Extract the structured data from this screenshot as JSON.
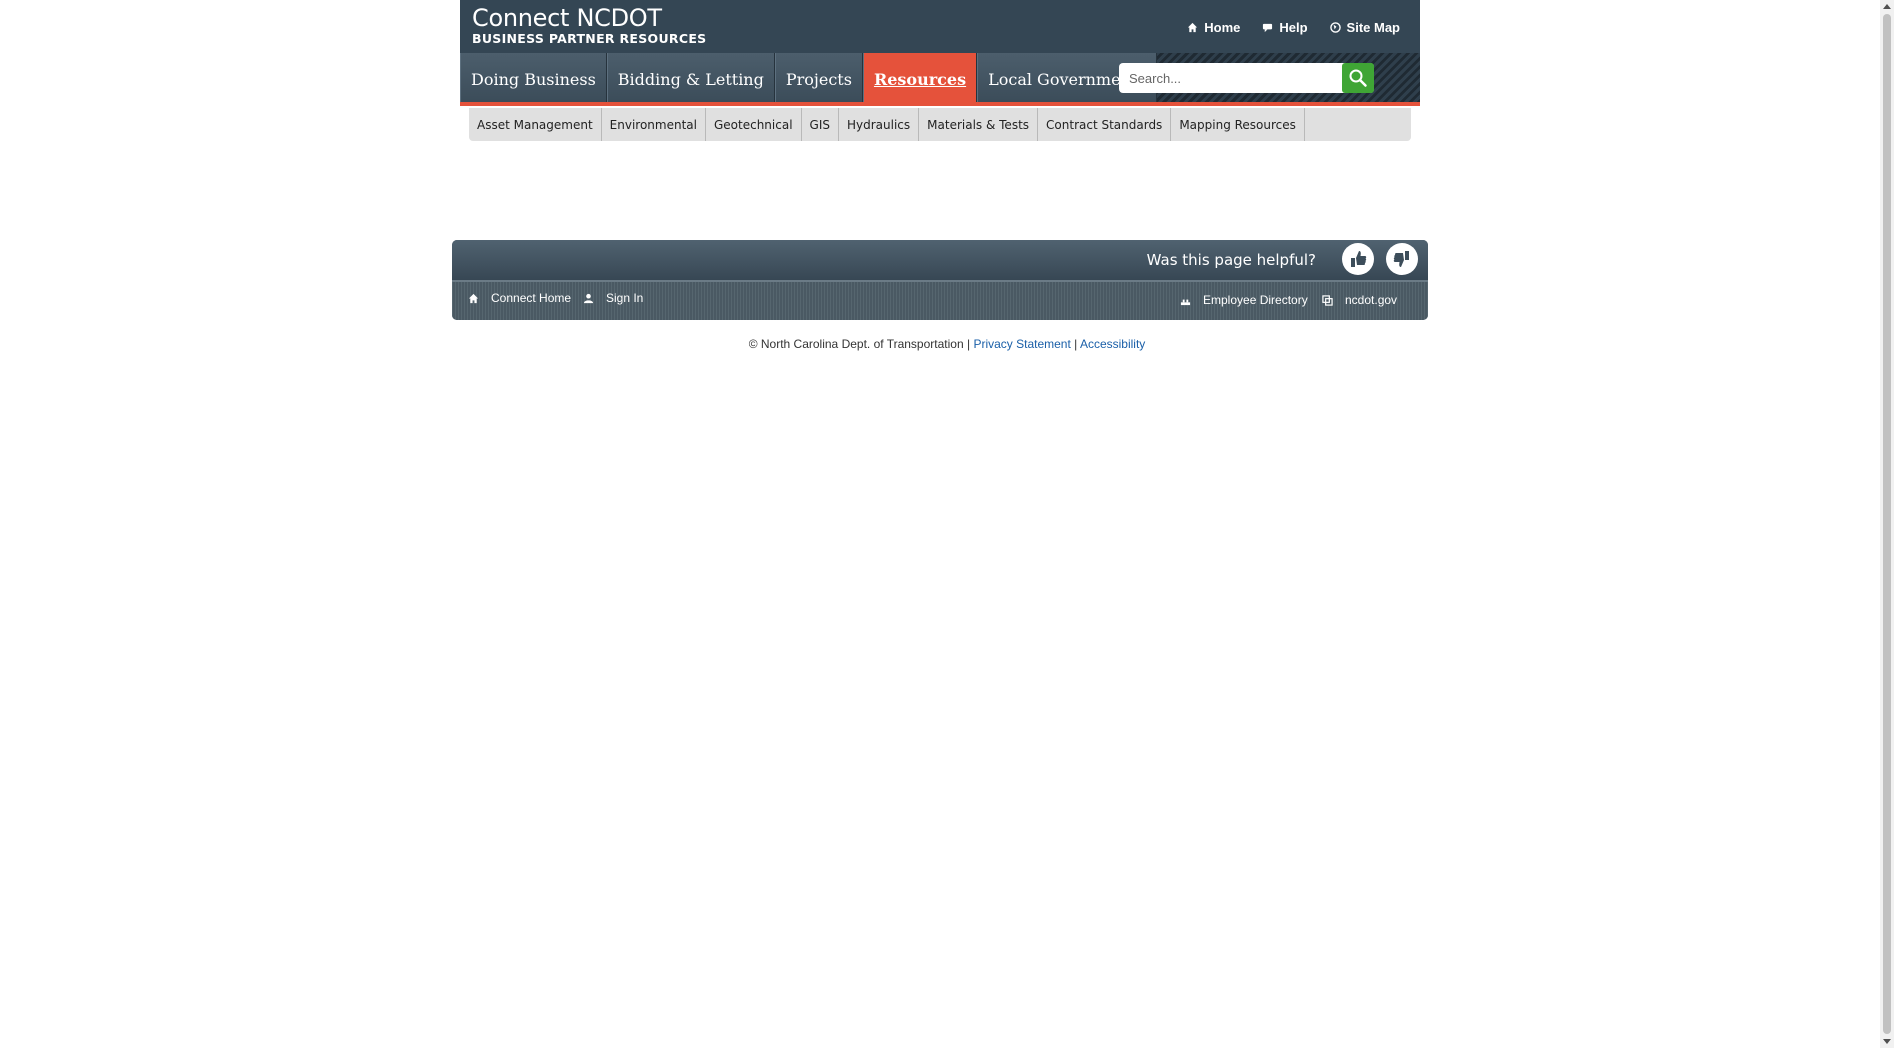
{
  "brand": {
    "title": "Connect NCDOT",
    "subtitle": "BUSINESS PARTNER RESOURCES"
  },
  "utility": {
    "home": "Home",
    "help": "Help",
    "site_map": "Site Map"
  },
  "nav": {
    "tabs": [
      "Doing Business",
      "Bidding & Letting",
      "Projects",
      "Resources",
      "Local Governments"
    ],
    "active": "Resources"
  },
  "search": {
    "placeholder": "Search...",
    "value": ""
  },
  "subnav": [
    "Asset Management",
    "Environmental",
    "Geotechnical",
    "GIS",
    "Hydraulics",
    "Materials & Tests",
    "Contract Standards",
    "Mapping Resources"
  ],
  "footer": {
    "helpful": "Was this page helpful?",
    "connect_home": "Connect Home",
    "sign_in": "Sign In",
    "employee_directory": "Employee Directory",
    "ncdot_gov": "ncdot.gov"
  },
  "copyright": {
    "text": "© North Carolina Dept. of Transportation |",
    "privacy": "Privacy Statement",
    "sep": "|",
    "accessibility": "Accessibility"
  },
  "colors": {
    "header": "#344654",
    "accent": "#e5523b",
    "search_button": "#3fa535",
    "link": "#1a5fa8"
  },
  "icons": [
    "home-icon",
    "help-icon",
    "globe-icon",
    "search-icon",
    "thumbs-up-icon",
    "thumbs-down-icon",
    "user-icon",
    "directory-icon",
    "external-link-icon"
  ]
}
